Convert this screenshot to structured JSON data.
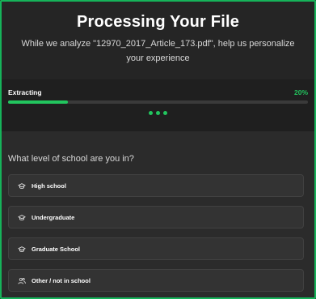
{
  "header": {
    "title": "Processing Your File",
    "subtitle": "While we analyze \"12970_2017_Article_173.pdf\", help us personalize your experience"
  },
  "progress": {
    "label": "Extracting",
    "percent_text": "20%",
    "value": 0.2,
    "accent_color": "#22c55e"
  },
  "loading_indicator": {
    "dots": 3
  },
  "survey": {
    "question": "What level of school are you in?",
    "options": [
      {
        "label": "High school",
        "icon": "graduation-cap-icon"
      },
      {
        "label": "Undergraduate",
        "icon": "graduation-cap-icon"
      },
      {
        "label": "Graduate School",
        "icon": "graduation-cap-icon"
      },
      {
        "label": "Other / not in school",
        "icon": "users-icon"
      }
    ]
  }
}
